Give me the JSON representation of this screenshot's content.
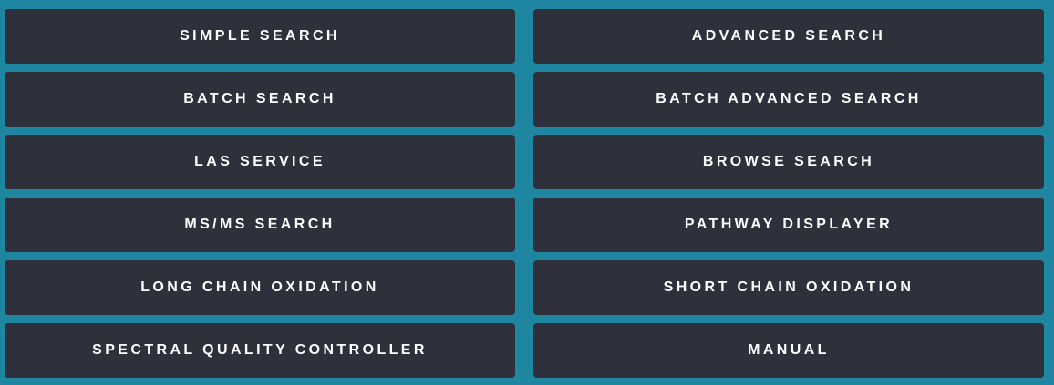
{
  "menu": {
    "buttons": [
      {
        "id": "simple-search-button",
        "label": "SIMPLE SEARCH"
      },
      {
        "id": "advanced-search-button",
        "label": "ADVANCED SEARCH"
      },
      {
        "id": "batch-search-button",
        "label": "BATCH SEARCH"
      },
      {
        "id": "batch-advanced-search-button",
        "label": "BATCH ADVANCED SEARCH"
      },
      {
        "id": "las-service-button",
        "label": "LAS SERVICE"
      },
      {
        "id": "browse-search-button",
        "label": "BROWSE SEARCH"
      },
      {
        "id": "msms-search-button",
        "label": "MS/MS SEARCH"
      },
      {
        "id": "pathway-displayer-button",
        "label": "PATHWAY DISPLAYER"
      },
      {
        "id": "long-chain-oxidation-button",
        "label": "LONG CHAIN OXIDATION"
      },
      {
        "id": "short-chain-oxidation-button",
        "label": "SHORT CHAIN OXIDATION"
      },
      {
        "id": "spectral-quality-controller-button",
        "label": "SPECTRAL QUALITY CONTROLLER"
      },
      {
        "id": "manual-button",
        "label": "MANUAL"
      }
    ]
  },
  "colors": {
    "background": "#1f86a2",
    "button_background": "#2e313b",
    "button_text": "#ffffff"
  }
}
